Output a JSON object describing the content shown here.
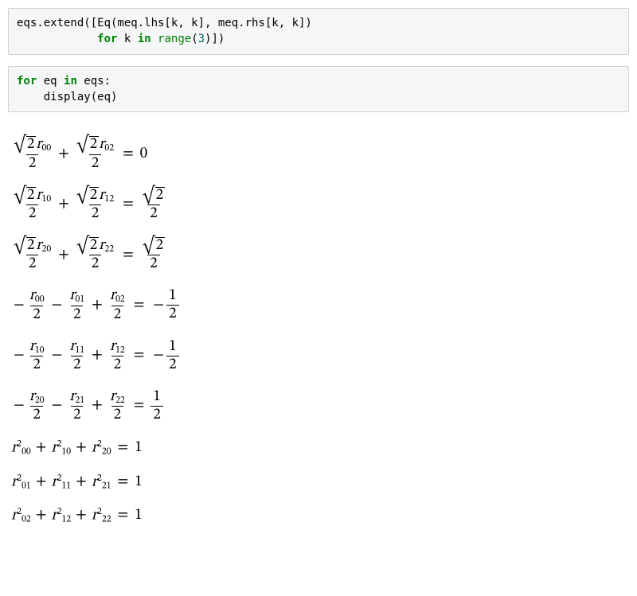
{
  "cells": {
    "cell1": {
      "tokens": [
        {
          "t": "eqs.extend([Eq(meq.lhs[k, k], meq.rhs[k, k])"
        },
        {
          "t": "\n            "
        },
        {
          "t": "for",
          "c": "kw"
        },
        {
          "t": " k "
        },
        {
          "t": "in",
          "c": "kw"
        },
        {
          "t": " "
        },
        {
          "t": "range",
          "c": "builtin"
        },
        {
          "t": "("
        },
        {
          "t": "3",
          "c": "num"
        },
        {
          "t": ")])"
        }
      ]
    },
    "cell2": {
      "tokens": [
        {
          "t": "for",
          "c": "kw"
        },
        {
          "t": " eq "
        },
        {
          "t": "in",
          "c": "kw"
        },
        {
          "t": " eqs:\n    display(eq)"
        }
      ]
    }
  },
  "equations": [
    {
      "id": 1,
      "lhs": [
        {
          "type": "frac",
          "num": [
            {
              "sqrt": "2"
            },
            {
              "var": "r",
              "sub": "00"
            }
          ],
          "den": "2"
        },
        {
          "op": "+"
        },
        {
          "type": "frac",
          "num": [
            {
              "sqrt": "2"
            },
            {
              "var": "r",
              "sub": "02"
            }
          ],
          "den": "2"
        }
      ],
      "rhs": [
        {
          "plain": "0"
        }
      ]
    },
    {
      "id": 2,
      "lhs": [
        {
          "type": "frac",
          "num": [
            {
              "sqrt": "2"
            },
            {
              "var": "r",
              "sub": "10"
            }
          ],
          "den": "2"
        },
        {
          "op": "+"
        },
        {
          "type": "frac",
          "num": [
            {
              "sqrt": "2"
            },
            {
              "var": "r",
              "sub": "12"
            }
          ],
          "den": "2"
        }
      ],
      "rhs": [
        {
          "type": "frac",
          "num": [
            {
              "sqrt": "2"
            }
          ],
          "den": "2"
        }
      ]
    },
    {
      "id": 3,
      "lhs": [
        {
          "type": "frac",
          "num": [
            {
              "sqrt": "2"
            },
            {
              "var": "r",
              "sub": "20"
            }
          ],
          "den": "2"
        },
        {
          "op": "+"
        },
        {
          "type": "frac",
          "num": [
            {
              "sqrt": "2"
            },
            {
              "var": "r",
              "sub": "22"
            }
          ],
          "den": "2"
        }
      ],
      "rhs": [
        {
          "type": "frac",
          "num": [
            {
              "sqrt": "2"
            }
          ],
          "den": "2"
        }
      ]
    },
    {
      "id": 4,
      "lhs": [
        {
          "neg": true
        },
        {
          "type": "frac",
          "num": [
            {
              "var": "r",
              "sub": "00"
            }
          ],
          "den": "2"
        },
        {
          "op": "−"
        },
        {
          "type": "frac",
          "num": [
            {
              "var": "r",
              "sub": "01"
            }
          ],
          "den": "2"
        },
        {
          "op": "+"
        },
        {
          "type": "frac",
          "num": [
            {
              "var": "r",
              "sub": "02"
            }
          ],
          "den": "2"
        }
      ],
      "rhs": [
        {
          "neg": true
        },
        {
          "type": "frac",
          "num": [
            {
              "plain": "1"
            }
          ],
          "den": "2"
        }
      ]
    },
    {
      "id": 5,
      "lhs": [
        {
          "neg": true
        },
        {
          "type": "frac",
          "num": [
            {
              "var": "r",
              "sub": "10"
            }
          ],
          "den": "2"
        },
        {
          "op": "−"
        },
        {
          "type": "frac",
          "num": [
            {
              "var": "r",
              "sub": "11"
            }
          ],
          "den": "2"
        },
        {
          "op": "+"
        },
        {
          "type": "frac",
          "num": [
            {
              "var": "r",
              "sub": "12"
            }
          ],
          "den": "2"
        }
      ],
      "rhs": [
        {
          "neg": true
        },
        {
          "type": "frac",
          "num": [
            {
              "plain": "1"
            }
          ],
          "den": "2"
        }
      ]
    },
    {
      "id": 6,
      "lhs": [
        {
          "neg": true
        },
        {
          "type": "frac",
          "num": [
            {
              "var": "r",
              "sub": "20"
            }
          ],
          "den": "2"
        },
        {
          "op": "−"
        },
        {
          "type": "frac",
          "num": [
            {
              "var": "r",
              "sub": "21"
            }
          ],
          "den": "2"
        },
        {
          "op": "+"
        },
        {
          "type": "frac",
          "num": [
            {
              "var": "r",
              "sub": "22"
            }
          ],
          "den": "2"
        }
      ],
      "rhs": [
        {
          "type": "frac",
          "num": [
            {
              "plain": "1"
            }
          ],
          "den": "2"
        }
      ]
    },
    {
      "id": 7,
      "lhs": [
        {
          "var": "r",
          "sub": "00",
          "sup": "2"
        },
        {
          "op": "+"
        },
        {
          "var": "r",
          "sub": "10",
          "sup": "2"
        },
        {
          "op": "+"
        },
        {
          "var": "r",
          "sub": "20",
          "sup": "2"
        }
      ],
      "rhs": [
        {
          "plain": "1"
        }
      ]
    },
    {
      "id": 8,
      "lhs": [
        {
          "var": "r",
          "sub": "01",
          "sup": "2"
        },
        {
          "op": "+"
        },
        {
          "var": "r",
          "sub": "11",
          "sup": "2"
        },
        {
          "op": "+"
        },
        {
          "var": "r",
          "sub": "21",
          "sup": "2"
        }
      ],
      "rhs": [
        {
          "plain": "1"
        }
      ]
    },
    {
      "id": 9,
      "lhs": [
        {
          "var": "r",
          "sub": "02",
          "sup": "2"
        },
        {
          "op": "+"
        },
        {
          "var": "r",
          "sub": "12",
          "sup": "2"
        },
        {
          "op": "+"
        },
        {
          "var": "r",
          "sub": "22",
          "sup": "2"
        }
      ],
      "rhs": [
        {
          "plain": "1"
        }
      ]
    }
  ]
}
